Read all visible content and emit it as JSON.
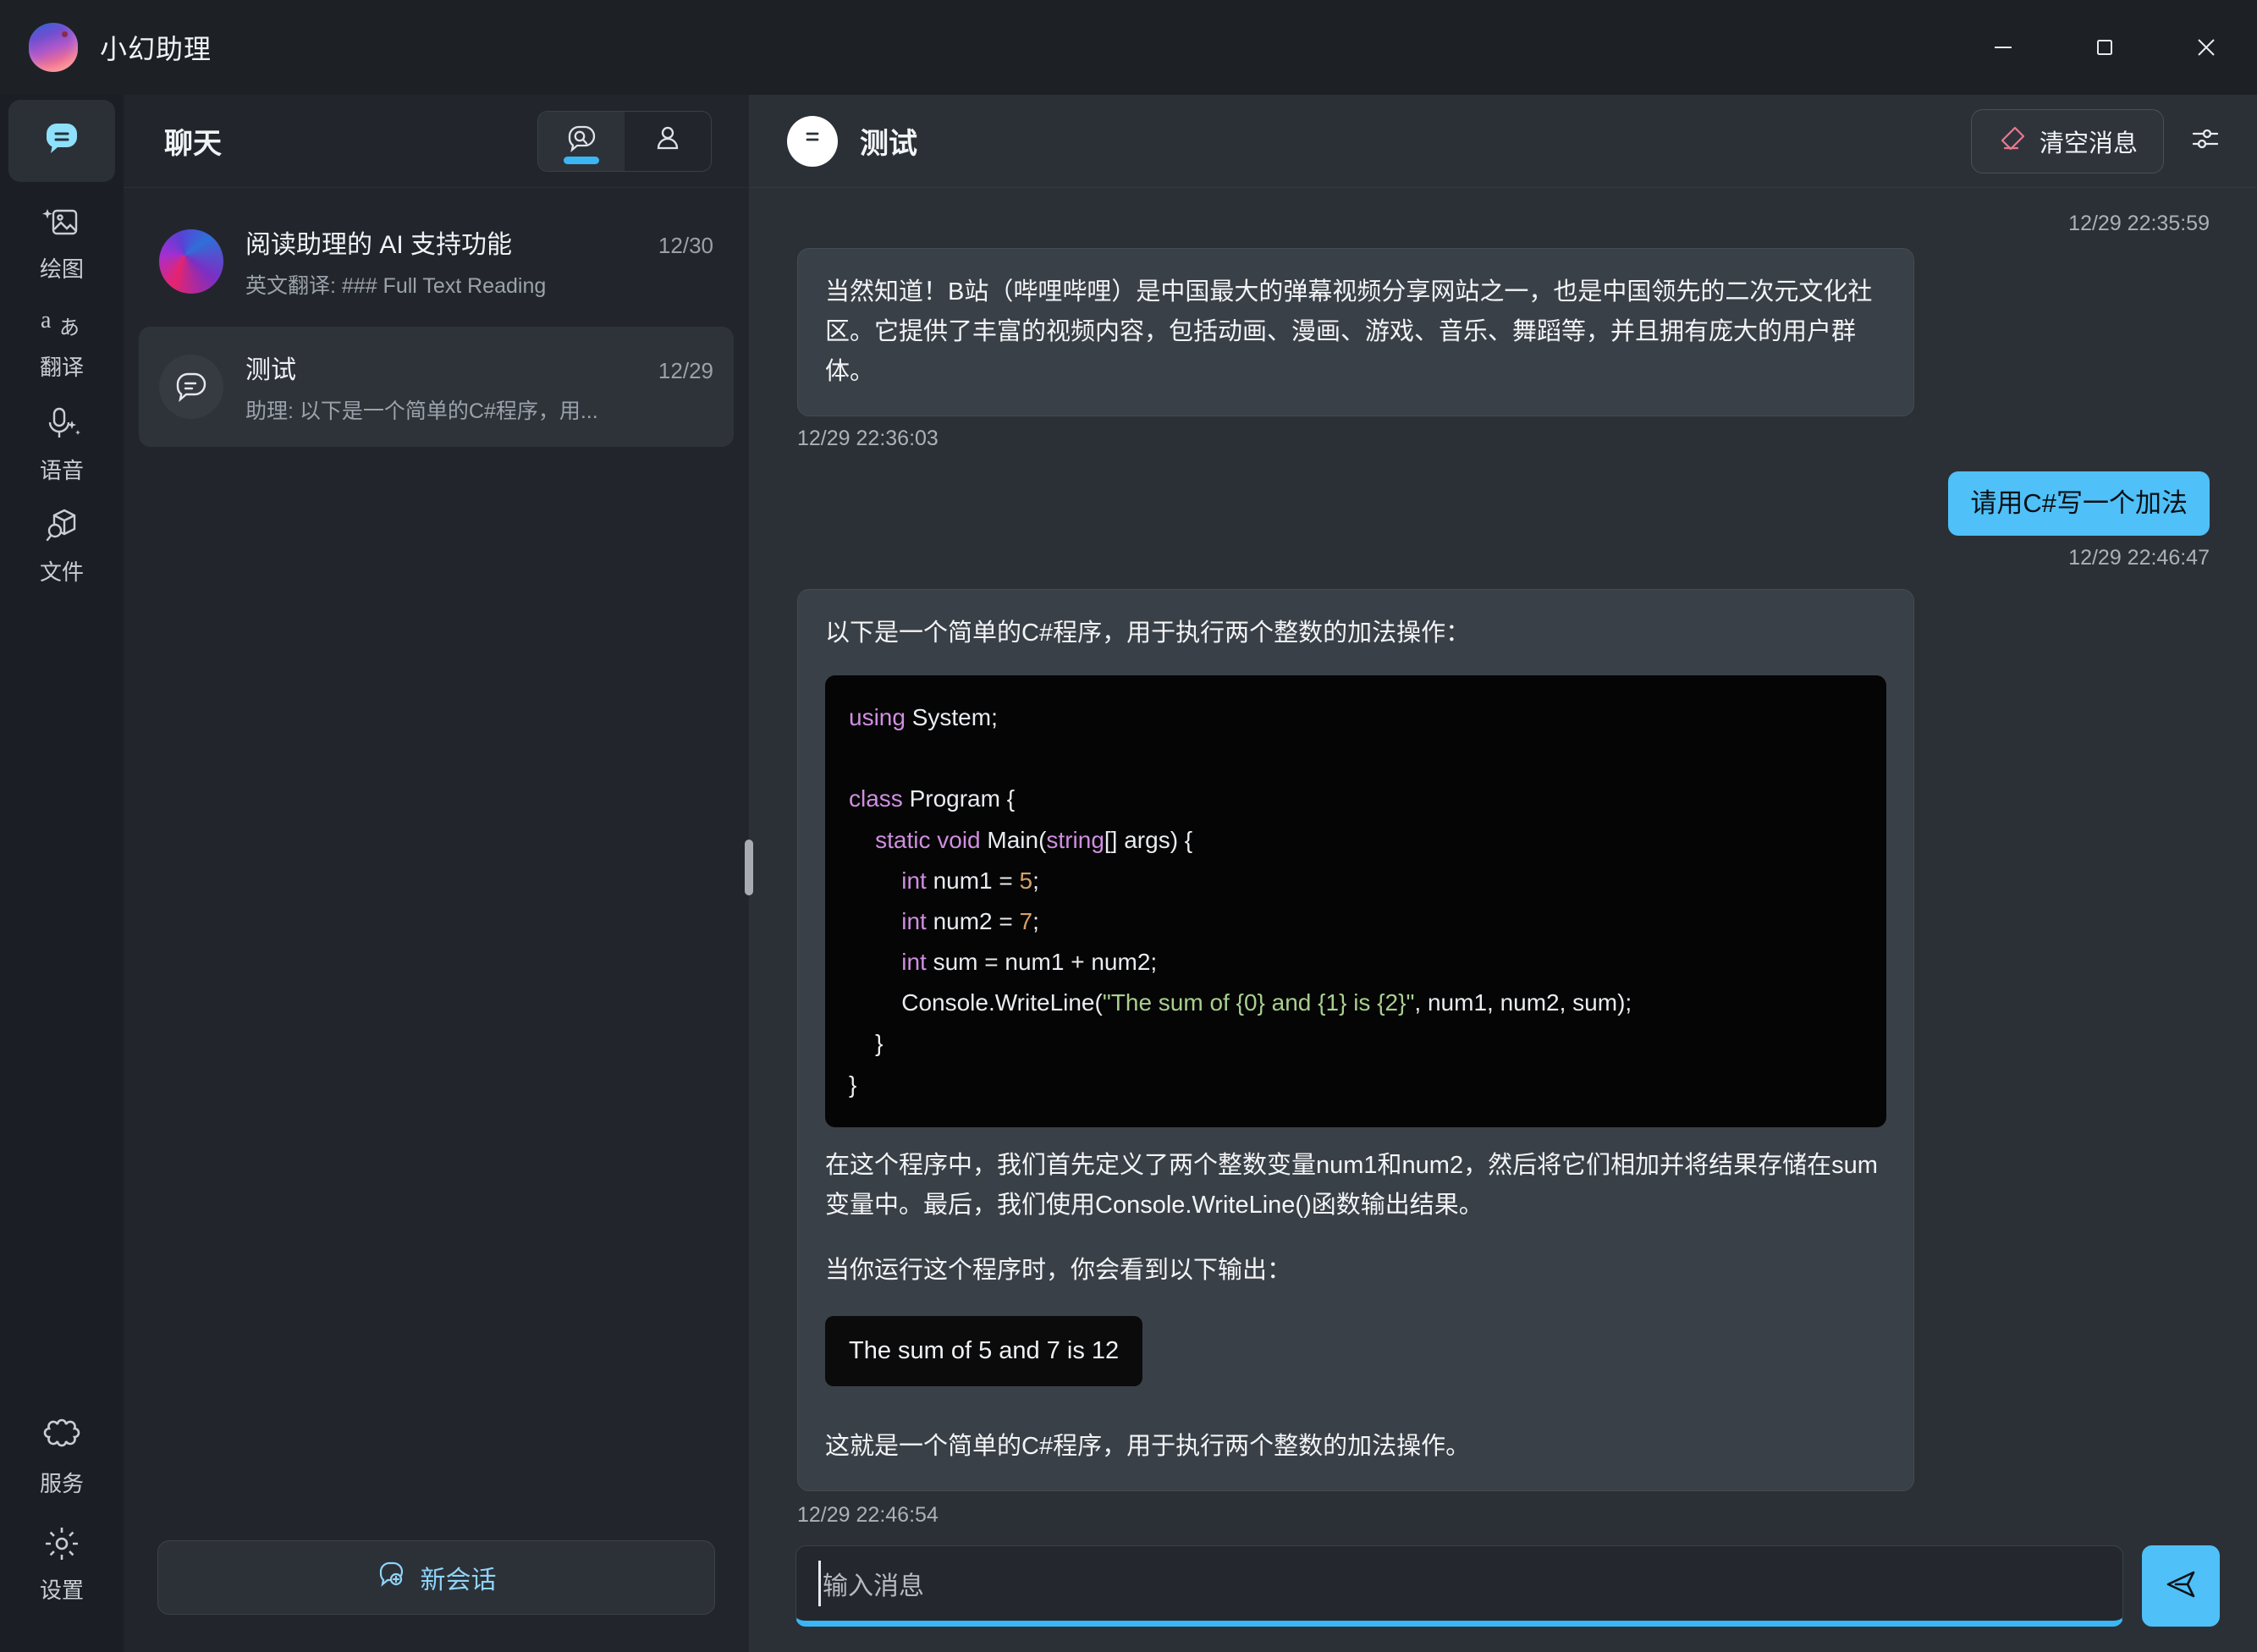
{
  "window": {
    "app_title": "小幻助理",
    "minimize_label": "minimize",
    "maximize_label": "maximize",
    "close_label": "close"
  },
  "rail": {
    "items": [
      {
        "id": "chat",
        "label": "",
        "icon": "chat-bubble-icon",
        "active": true
      },
      {
        "id": "draw",
        "label": "绘图",
        "icon": "image-sparkle-icon",
        "active": false
      },
      {
        "id": "translate",
        "label": "翻译",
        "icon": "translate-aa-icon",
        "active": false
      },
      {
        "id": "voice",
        "label": "语音",
        "icon": "microphone-sparkle-icon",
        "active": false
      },
      {
        "id": "files",
        "label": "文件",
        "icon": "box-search-icon",
        "active": false
      }
    ],
    "bottom_items": [
      {
        "id": "services",
        "label": "服务",
        "icon": "puzzle-icon"
      },
      {
        "id": "settings",
        "label": "设置",
        "icon": "gear-icon"
      }
    ]
  },
  "list_pane": {
    "title": "聊天",
    "tabs": [
      {
        "id": "chats",
        "icon": "chat-search-icon",
        "active": true
      },
      {
        "id": "contacts",
        "icon": "person-icon",
        "active": false
      }
    ],
    "conversations": [
      {
        "title": "阅读助理的 AI 支持功能",
        "date": "12/30",
        "preview": "英文翻译: ### Full Text Reading",
        "avatar": "gradient-orb-avatar",
        "selected": false
      },
      {
        "title": "测试",
        "date": "12/29",
        "preview": "助理: 以下是一个简单的C#程序，用...",
        "avatar": "chat-bubble-avatar",
        "selected": true
      }
    ],
    "new_chat_label": "新会话",
    "new_chat_icon": "chat-plus-icon"
  },
  "main": {
    "avatar_icon": "chat-bubble-icon",
    "title": "测试",
    "clear_button_label": "清空消息",
    "clear_button_icon": "eraser-icon",
    "settings_icon": "sliders-icon",
    "messages": [
      {
        "role": "assistant",
        "timestamp_top": "12/29 22:35:59",
        "text": "当然知道！B站（哔哩哔哩）是中国最大的弹幕视频分享网站之一，也是中国领先的二次元文化社区。它提供了丰富的视频内容，包括动画、漫画、游戏、音乐、舞蹈等，并且拥有庞大的用户群体。",
        "timestamp_bottom": "12/29 22:36:03"
      },
      {
        "role": "user",
        "text": "请用C#写一个加法",
        "timestamp_bottom": "12/29 22:46:47"
      },
      {
        "role": "assistant",
        "intro": "以下是一个简单的C#程序，用于执行两个整数的加法操作：",
        "code_lines": [
          [
            {
              "t": "using",
              "c": "k"
            },
            {
              "t": " System;",
              "c": ""
            }
          ],
          [
            {
              "t": "",
              "c": ""
            }
          ],
          [
            {
              "t": "class",
              "c": "k"
            },
            {
              "t": " Program {",
              "c": ""
            }
          ],
          [
            {
              "t": "    ",
              "c": ""
            },
            {
              "t": "static void",
              "c": "k"
            },
            {
              "t": " Main(",
              "c": ""
            },
            {
              "t": "string",
              "c": "k"
            },
            {
              "t": "[] args) {",
              "c": ""
            }
          ],
          [
            {
              "t": "        ",
              "c": ""
            },
            {
              "t": "int",
              "c": "k"
            },
            {
              "t": " num1 = ",
              "c": ""
            },
            {
              "t": "5",
              "c": "n"
            },
            {
              "t": ";",
              "c": ""
            }
          ],
          [
            {
              "t": "        ",
              "c": ""
            },
            {
              "t": "int",
              "c": "k"
            },
            {
              "t": " num2 = ",
              "c": ""
            },
            {
              "t": "7",
              "c": "n"
            },
            {
              "t": ";",
              "c": ""
            }
          ],
          [
            {
              "t": "        ",
              "c": ""
            },
            {
              "t": "int",
              "c": "k"
            },
            {
              "t": " sum = num1 + num2;",
              "c": ""
            }
          ],
          [
            {
              "t": "        Console.WriteLine(",
              "c": ""
            },
            {
              "t": "\"The sum of {0} and {1} is {2}\"",
              "c": "s"
            },
            {
              "t": ", num1, num2, sum);",
              "c": ""
            }
          ],
          [
            {
              "t": "    }",
              "c": ""
            }
          ],
          [
            {
              "t": "}",
              "c": ""
            }
          ]
        ],
        "para1": "在这个程序中，我们首先定义了两个整数变量num1和num2，然后将它们相加并将结果存储在sum变量中。最后，我们使用Console.WriteLine()函数输出结果。",
        "para2": "当你运行这个程序时，你会看到以下输出：",
        "output": "The sum of 5 and 7 is 12",
        "para3": "这就是一个简单的C#程序，用于执行两个整数的加法操作。",
        "timestamp_bottom": "12/29 22:46:54"
      }
    ],
    "composer": {
      "placeholder": "输入消息",
      "value": "",
      "send_icon": "send-arrow-icon"
    }
  },
  "colors": {
    "accent": "#4fc0f8",
    "accent_light": "#8fd4f8",
    "danger": "#e8798f",
    "code_keyword": "#cf8ee0",
    "code_string": "#a9cf8e",
    "code_number": "#d6a16a",
    "window_bg": "#1d2126",
    "panel_bg": "#22262c",
    "main_bg": "#2b3036"
  }
}
